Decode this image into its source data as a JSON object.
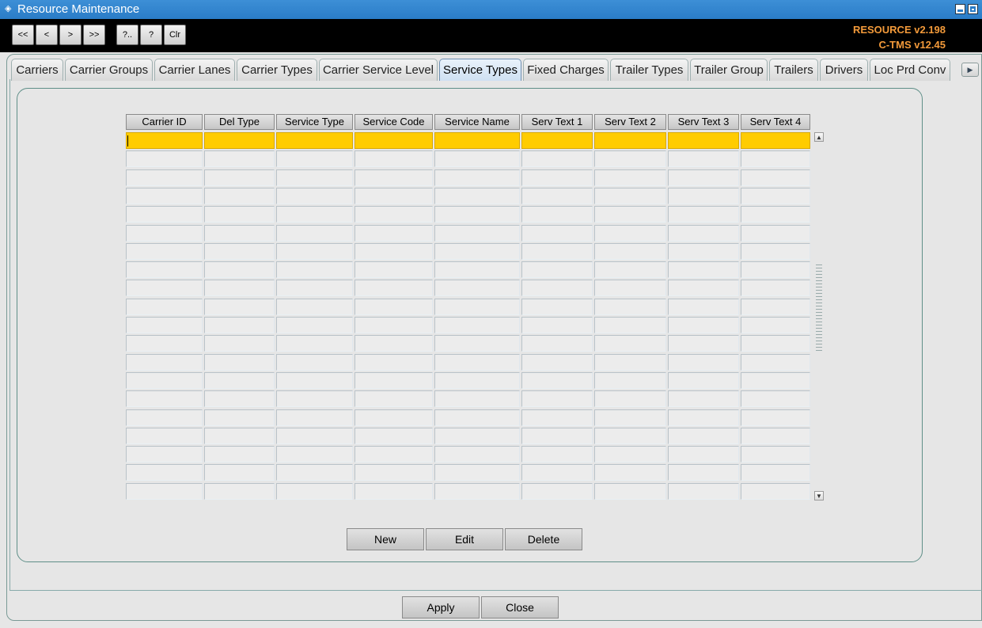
{
  "window": {
    "title": "Resource Maintenance",
    "icon": "app-icon"
  },
  "toolbar": {
    "buttons": [
      "<<",
      "<",
      ">",
      ">>",
      "?..",
      "?",
      "Clr"
    ],
    "version_resource": "RESOURCE v2.198",
    "version_ctms": "C-TMS v12.45",
    "version_color": "#f39a3a"
  },
  "tabs": [
    "Carriers",
    "Carrier Groups",
    "Carrier Lanes",
    "Carrier Types",
    "Carrier Service Level",
    "Service Types",
    "Fixed Charges",
    "Trailer Types",
    "Trailer Group",
    "Trailers",
    "Drivers",
    "Loc Prd Conv"
  ],
  "active_tab": "Service Types",
  "grid": {
    "columns": [
      "Carrier ID",
      "Del Type",
      "Service Type",
      "Service Code",
      "Service Name",
      "Serv Text 1",
      "Serv Text 2",
      "Serv Text 3",
      "Serv Text 4"
    ],
    "row_count": 20,
    "selected_row": 0,
    "selected_color": "#ffcc00"
  },
  "actions": {
    "new_label": "New",
    "edit_label": "Edit",
    "delete_label": "Delete"
  },
  "footer": {
    "apply_label": "Apply",
    "close_label": "Close"
  }
}
